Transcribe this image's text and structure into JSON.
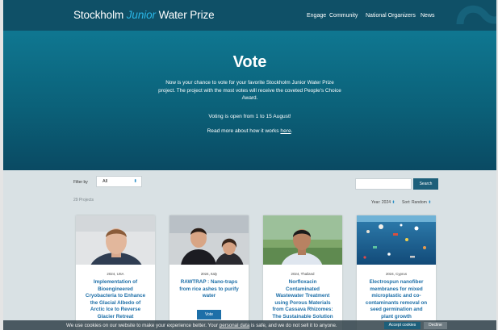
{
  "header": {
    "brand": {
      "part1": "Stockholm",
      "part2": "Junior",
      "part3": "Water Prize"
    },
    "nav": [
      "Engage",
      "Community",
      "National Organizers",
      "News"
    ]
  },
  "hero": {
    "title": "Vote",
    "description": "Now is your chance to vote for your favorite Stockholm Junior Water Prize project. The project with the most votes will receive the coveted People's Choice Award.",
    "dates": "Voting is open from 1 to 15 August!",
    "more_prefix": "Read more about how it works",
    "more_link": "here",
    "more_suffix": "."
  },
  "filters": {
    "filter_label": "Filter by",
    "filter_value": "All",
    "search_placeholder": "",
    "search_button": "Search",
    "project_count": "29 Projects",
    "year_label": "Year: 2024",
    "sort_label": "Sort: Random"
  },
  "projects": [
    {
      "meta": "2024, USA",
      "title": "Implementation of Bioengineered Cryobacteria to Enhance the Glacial Albedo of Arctic Ice to Reverse Glacier Retreat",
      "image": "portrait-boy"
    },
    {
      "meta": "2024, Italy",
      "title": "RAWTRAP : Nano-traps from rice ashes to purify water",
      "image": "two-students",
      "vote_label": "Vote"
    },
    {
      "meta": "2024, Thailand",
      "title": "Norfloxacin Contaminated Wastewater Treatment using Porous Materials from Cassava Rhizomes: The Sustainable Solution",
      "image": "portrait-outdoor"
    },
    {
      "meta": "2024, Cyprus",
      "title": "Electrospun nanofiber membranes for mixed microplastic and co-contaminants removal on seed germination and plant growth",
      "image": "underwater-plastic"
    }
  ],
  "cookie": {
    "text_prefix": "We use cookies on our website to make your experience better. Your",
    "link": "personal data",
    "text_suffix": "is safe, and we do not sell it to anyone.",
    "accept": "Accept cookies",
    "decline": "Decline"
  },
  "colors": {
    "topbar": "#0f5067",
    "hero": "#0b6179",
    "accent": "#1d6fa8",
    "junior": "#2ab6e6"
  }
}
